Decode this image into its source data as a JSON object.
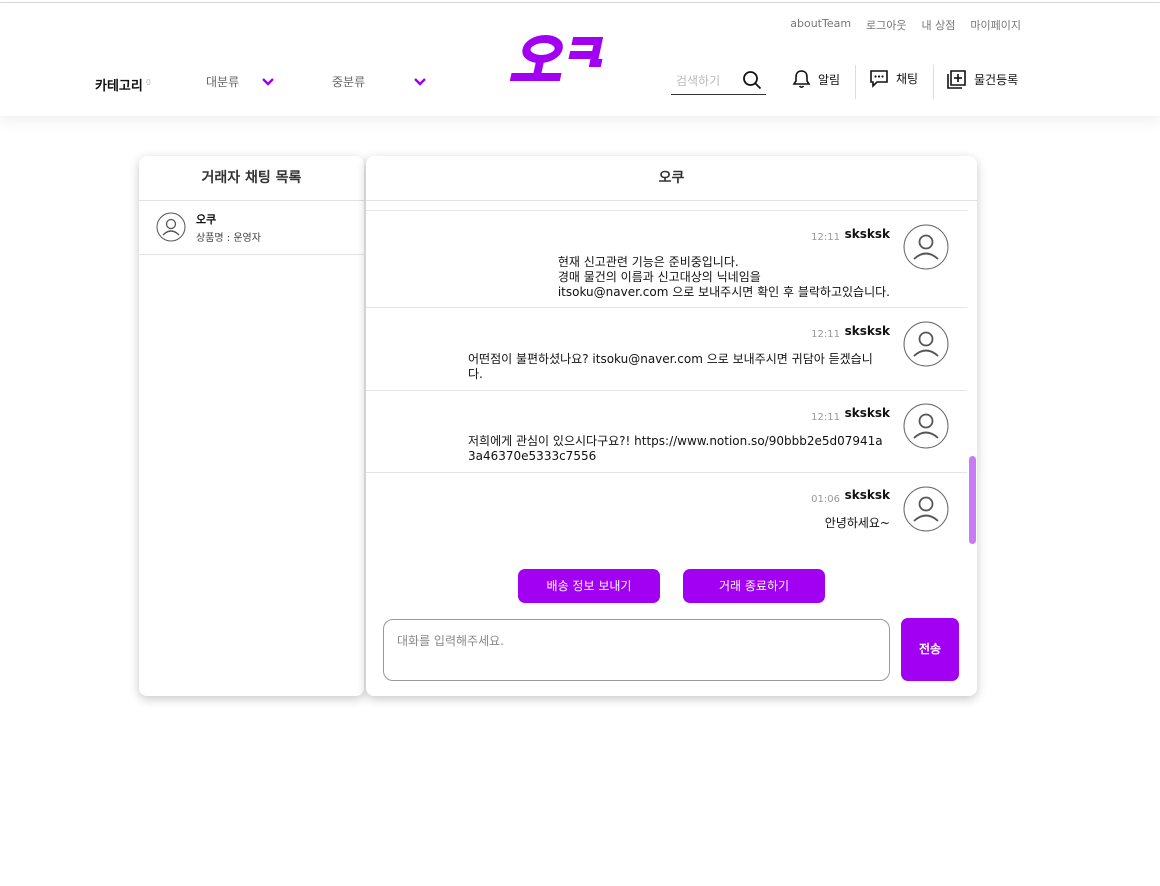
{
  "header": {
    "util_links": [
      "aboutTeam",
      "로그아웃",
      "내 상점",
      "마이페이지"
    ],
    "logo_text": "오쿠",
    "category_label": "카테고리",
    "category_badge": "0",
    "major_label": "대분류",
    "minor_label": "중분류",
    "search_placeholder": "검색하기",
    "alarm_label": "알림",
    "chat_label": "채팅",
    "register_label": "물건등록"
  },
  "colors": {
    "accent": "#a100f2",
    "scrollbar": "#c97af5"
  },
  "chat_list": {
    "title": "거래자 채팅 목록",
    "items": [
      {
        "name": "오쿠",
        "product": "상품명 : 운영자"
      }
    ]
  },
  "chat_room": {
    "title": "오쿠",
    "messages": [
      {
        "time": "12:11",
        "user": "sksksk",
        "lines": [
          "현재 신고관련 기능은 준비중입니다.",
          "경매 물건의 이름과 신고대상의 닉네임을",
          "itsoku@naver.com 으로 보내주시면 확인 후 블락하고있습니다."
        ]
      },
      {
        "time": "12:11",
        "user": "sksksk",
        "lines": [
          "어떤점이 불편하셨나요? itsoku@naver.com 으로 보내주시면 귀담아 듣겠습니",
          "다."
        ]
      },
      {
        "time": "12:11",
        "user": "sksksk",
        "lines": [
          "저희에게 관심이 있으시다구요?! https://www.notion.so/90bbb2e5d07941a",
          "3a46370e5333c7556"
        ]
      },
      {
        "time": "01:06",
        "user": "sksksk",
        "lines": [
          "안녕하세요~"
        ]
      }
    ],
    "send_shipping_label": "배송 정보 보내기",
    "end_trade_label": "거래 종료하기",
    "input_placeholder": "대화를 입력해주세요.",
    "send_label": "전송"
  }
}
